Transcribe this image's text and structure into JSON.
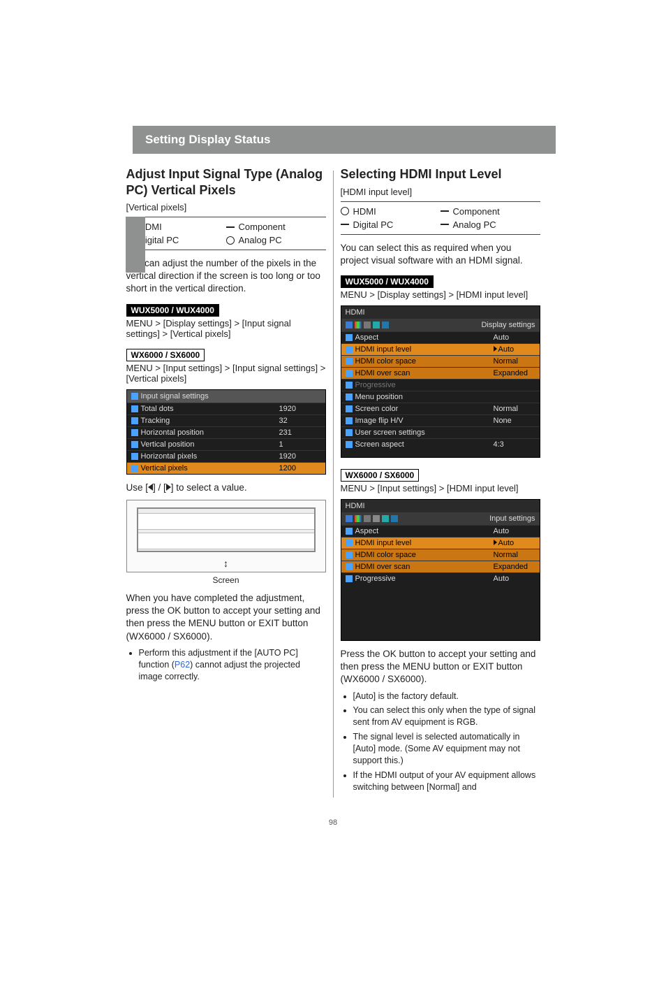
{
  "header": {
    "band": "Setting Display Status"
  },
  "page_number": "98",
  "left": {
    "heading": "Adjust Input Signal Type (Analog PC) Vertical Pixels",
    "bracket": "[Vertical pixels]",
    "compat": {
      "hdmi": "HDMI",
      "component": "Component",
      "digitalpc": "Digital PC",
      "analogpc": "Analog PC"
    },
    "intro": "You can adjust the number of the pixels in the vertical direction if the screen is too long or too short in the vertical direction.",
    "badge1": "WUX5000 / WUX4000",
    "path1": "MENU > [Display settings] > [Input signal settings] > [Vertical pixels]",
    "badge2": "WX6000 / SX6000",
    "path2": "MENU > [Input settings] > [Input signal settings] > [Vertical pixels]",
    "osd": {
      "title": "Input signal settings",
      "rows": [
        {
          "k": "Total dots",
          "v": "1920"
        },
        {
          "k": "Tracking",
          "v": "32"
        },
        {
          "k": "Horizontal position",
          "v": "231"
        },
        {
          "k": "Vertical position",
          "v": "1"
        },
        {
          "k": "Horizontal pixels",
          "v": "1920"
        },
        {
          "k": "Vertical pixels",
          "v": "1200",
          "hi": true
        }
      ]
    },
    "use_pre": "Use [",
    "use_mid": "] / [",
    "use_post": "] to select a value.",
    "screen_caption": "Screen",
    "after": "When you have completed the adjustment, press the OK button to accept your setting and then press the MENU button or EXIT button (WX6000 / SX6000).",
    "bullets": [
      {
        "pre": "Perform this adjustment if the [AUTO PC] function (",
        "link": "P62",
        "post": ") cannot adjust the projected image correctly."
      }
    ]
  },
  "right": {
    "heading": "Selecting HDMI Input Level",
    "bracket": "[HDMI input level]",
    "compat": {
      "hdmi": "HDMI",
      "component": "Component",
      "digitalpc": "Digital PC",
      "analogpc": "Analog PC"
    },
    "intro": "You can select this as required when you project visual software with an HDMI signal.",
    "badge1": "WUX5000 / WUX4000",
    "path1": "MENU > [Display settings] > [HDMI input level]",
    "osd1": {
      "tab": "HDMI",
      "title": "Display settings",
      "rows": [
        {
          "k": "Aspect",
          "v": "Auto"
        },
        {
          "k": "HDMI input level",
          "v": "Auto",
          "hi": true,
          "arrow": true
        },
        {
          "k": "HDMI color space",
          "v": "Normal",
          "hi2": true
        },
        {
          "k": "HDMI over scan",
          "v": "Expanded",
          "hi2": true
        },
        {
          "k": "Progressive",
          "v": "",
          "dim": true
        },
        {
          "k": "Menu position",
          "v": ""
        },
        {
          "k": "Screen color",
          "v": "Normal"
        },
        {
          "k": "Image flip H/V",
          "v": "None"
        },
        {
          "k": "User screen settings",
          "v": ""
        },
        {
          "k": "Screen aspect",
          "v": "4:3"
        }
      ]
    },
    "badge2": "WX6000 / SX6000",
    "path2": "MENU > [Input settings] > [HDMI input level]",
    "osd2": {
      "tab": "HDMI",
      "title": "Input settings",
      "rows": [
        {
          "k": "Aspect",
          "v": "Auto"
        },
        {
          "k": "HDMI input level",
          "v": "Auto",
          "hi": true,
          "arrow": true
        },
        {
          "k": "HDMI color space",
          "v": "Normal",
          "hi2": true
        },
        {
          "k": "HDMI over scan",
          "v": "Expanded",
          "hi2": true
        },
        {
          "k": "Progressive",
          "v": "Auto"
        }
      ]
    },
    "after": "Press the OK button to accept your setting and then press the MENU button or EXIT button (WX6000 / SX6000).",
    "bullets": [
      "[Auto] is the factory default.",
      "You can select this only when the type of signal sent from AV equipment is RGB.",
      "The signal level is selected automatically in [Auto] mode. (Some AV equipment may not support this.)",
      "If the HDMI output of your AV equipment allows switching between [Normal] and"
    ]
  }
}
